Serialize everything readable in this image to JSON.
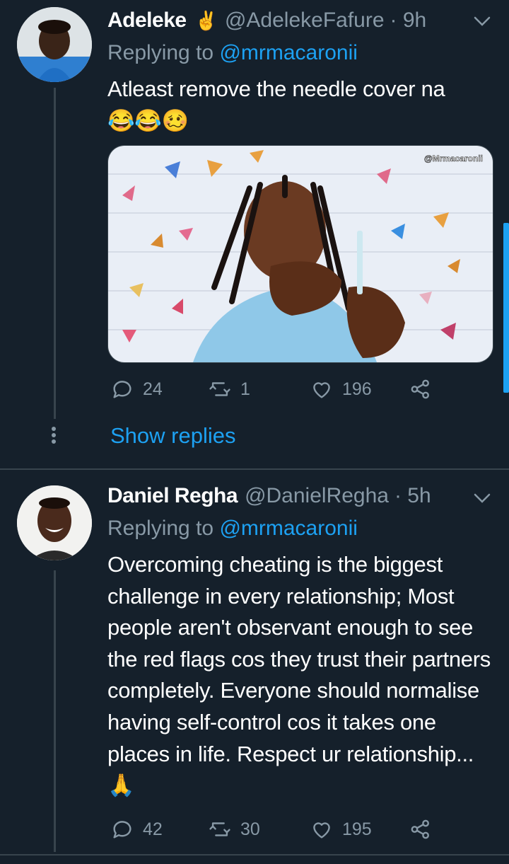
{
  "tweets": [
    {
      "name": "Adeleke",
      "badge_emoji": "✌️",
      "handle": "@AdelekeFafure",
      "time": "· 9h",
      "replying_prefix": "Replying to",
      "replying_to": "@mrmacaronii",
      "text_line1": "Atleast remove the needle cover na",
      "text_line2": "😂😂🥴",
      "media_watermark": "@Mrmacaronii",
      "replies": "24",
      "retweets": "1",
      "likes": "196",
      "show_replies": "Show replies"
    },
    {
      "name": "Daniel Regha",
      "handle": "@DanielRegha",
      "time": "· 5h",
      "replying_prefix": "Replying to",
      "replying_to": "@mrmacaronii",
      "text": "Overcoming cheating is the biggest challenge in every relationship; Most people aren't observant enough to see the red flags cos they trust their partners completely. Everyone should normalise having self-control cos it takes one places in life. Respect ur relationship...🙏",
      "replies": "42",
      "retweets": "30",
      "likes": "195"
    }
  ],
  "colors": {
    "background": "#15202b",
    "secondary_text": "#8899a6",
    "accent": "#1da1f2",
    "divider": "#38444d"
  },
  "icons": [
    "chevron-down-icon",
    "reply-icon",
    "retweet-icon",
    "like-icon",
    "share-icon"
  ]
}
